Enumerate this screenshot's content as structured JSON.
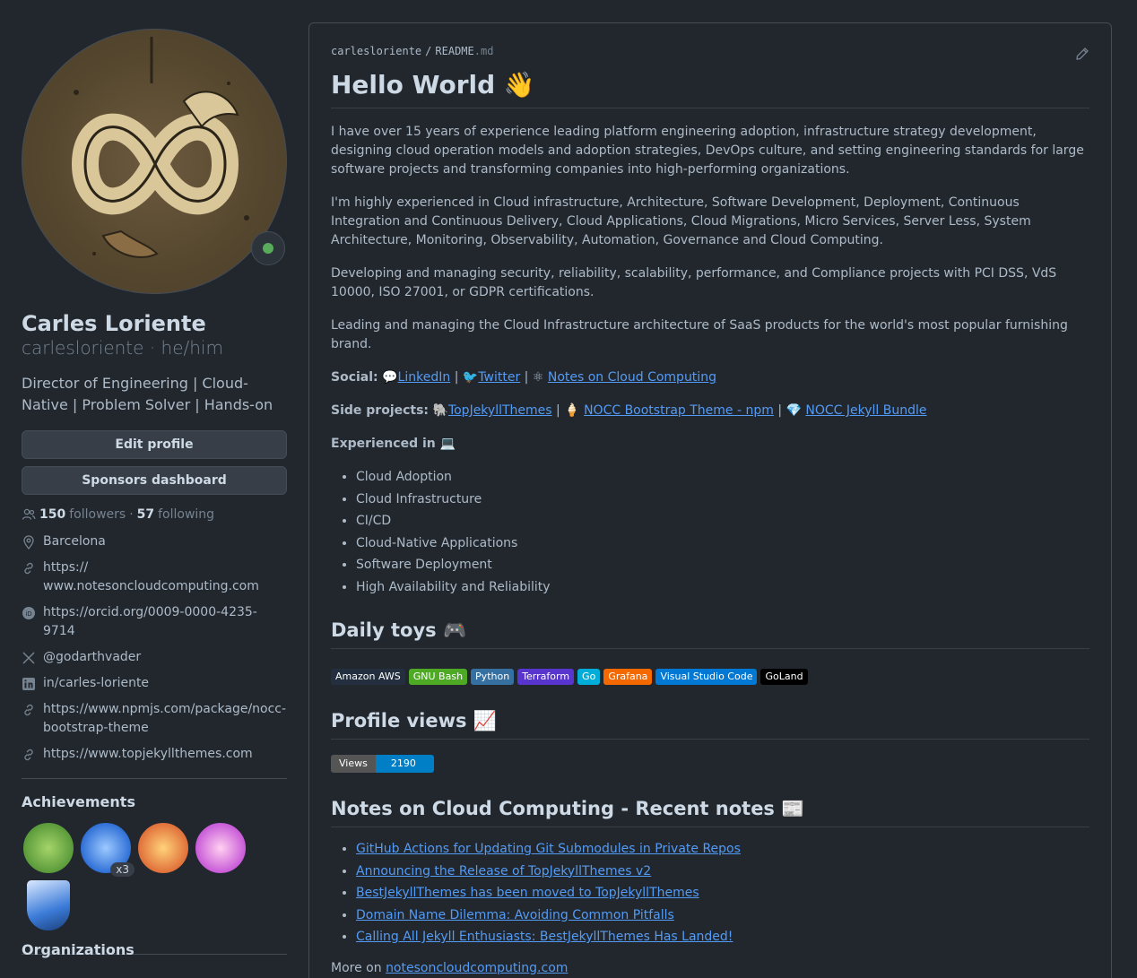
{
  "profile": {
    "full_name": "Carles Loriente",
    "login_line": "carlesloriente · he/him",
    "bio": "Director of Engineering | Cloud-Native | Problem Solver | Hands-on",
    "edit_label": "Edit profile",
    "sponsors_label": "Sponsors dashboard",
    "followers_count": "150",
    "followers_label": "followers",
    "sep": "·",
    "following_count": "57",
    "following_label": "following",
    "details": [
      {
        "icon": "location-icon",
        "text": "Barcelona"
      },
      {
        "icon": "link-icon",
        "text": "https://\nwww.notesoncloudcomputing.com"
      },
      {
        "icon": "orcid-icon",
        "text": "https://orcid.org/0009-0000-4235-9714"
      },
      {
        "icon": "x-icon",
        "text": "@godarthvader"
      },
      {
        "icon": "linkedin-icon",
        "text": "in/carles-loriente"
      },
      {
        "icon": "link-icon",
        "text": "https://www.npmjs.com/package/nocc-\nbootstrap-theme"
      },
      {
        "icon": "link-icon",
        "text": "https://www.topjekyllthemes.com"
      }
    ],
    "achievements_title": "Achievements",
    "achievement_multiplier": "x3",
    "organizations_title": "Organizations"
  },
  "readme": {
    "crumb_user": "carlesloriente",
    "crumb_sep": "/",
    "crumb_file": "README",
    "crumb_ext": ".md",
    "title": "Hello World 👋",
    "paragraphs": [
      "I have over 15 years of experience leading platform engineering adoption, infrastructure strategy development, designing cloud operation models and adoption strategies, DevOps culture, and setting engineering standards for large software projects and transforming companies into high-performing organizations.",
      "I'm highly experienced in Cloud infrastructure, Architecture, Software Development, Deployment, Continuous Integration and Continuous Delivery, Cloud Applications, Cloud Migrations, Micro Services, Server Less, System Architecture, Monitoring, Observability, Automation, Governance and Cloud Computing.",
      "Developing and managing security, reliability, scalability, performance, and Compliance projects with PCI DSS, VdS 10000, ISO 27001, or GDPR certifications.",
      "Leading and managing the Cloud Infrastructure architecture of SaaS products for the world's most popular furnishing brand."
    ],
    "social_label": "Social:",
    "social_links": [
      {
        "emoji": "💬",
        "text": "LinkedIn"
      },
      {
        "emoji": "🐦",
        "text": "Twitter"
      },
      {
        "emoji": "⚛",
        "text": "Notes on Cloud Computing"
      }
    ],
    "side_label": "Side projects:",
    "side_links": [
      {
        "emoji": "🐘",
        "text": "TopJekyllThemes"
      },
      {
        "emoji": "🍦",
        "text": "NOCC Bootstrap Theme - npm"
      },
      {
        "emoji": "💎",
        "text": "NOCC Jekyll Bundle"
      }
    ],
    "pipe": "|",
    "experienced_label": "Experienced in 💻",
    "experienced_items": [
      "Cloud Adoption",
      "Cloud Infrastructure",
      "CI/CD",
      "Cloud-Native Applications",
      "Software Deployment",
      "High Availability and Reliability"
    ],
    "toys_title": "Daily toys 🎮",
    "shields": [
      {
        "text": "Amazon AWS",
        "color": "#232f3e"
      },
      {
        "text": "GNU Bash",
        "color": "#4eaa25"
      },
      {
        "text": "Python",
        "color": "#3670a0"
      },
      {
        "text": "Terraform",
        "color": "#5835cc"
      },
      {
        "text": "Go",
        "color": "#00add8"
      },
      {
        "text": "Grafana",
        "color": "#f46800"
      },
      {
        "text": "Visual Studio Code",
        "color": "#0078d4"
      },
      {
        "text": "GoLand",
        "color": "#000000"
      }
    ],
    "views_title": "Profile views 📈",
    "views_label": "Views",
    "views_value": "2190",
    "notes_title": "Notes on Cloud Computing - Recent notes 📰",
    "notes": [
      "GitHub Actions for Updating Git Submodules in Private Repos",
      "Announcing the Release of TopJekyllThemes v2",
      "BestJekyllThemes has been moved to TopJekyllThemes",
      "Domain Name Dilemma: Avoiding Common Pitfalls",
      "Calling All Jekyll Enthusiasts: BestJekyllThemes Has Landed!"
    ],
    "more_prefix": "More on",
    "more_link": "notesoncloudcomputing.com"
  }
}
